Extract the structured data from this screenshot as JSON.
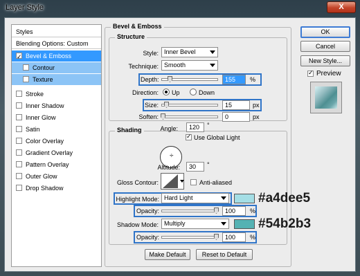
{
  "window": {
    "title": "Layer Style",
    "close_label": "X"
  },
  "sidebar": {
    "styles_label": "Styles",
    "blending_label": "Blending Options: Custom",
    "items": [
      {
        "label": "Bevel & Emboss",
        "checked": true
      },
      {
        "label": "Contour",
        "checked": false
      },
      {
        "label": "Texture",
        "checked": false
      },
      {
        "label": "Stroke",
        "checked": false
      },
      {
        "label": "Inner Shadow",
        "checked": false
      },
      {
        "label": "Inner Glow",
        "checked": false
      },
      {
        "label": "Satin",
        "checked": false
      },
      {
        "label": "Color Overlay",
        "checked": false
      },
      {
        "label": "Gradient Overlay",
        "checked": false
      },
      {
        "label": "Pattern Overlay",
        "checked": false
      },
      {
        "label": "Outer Glow",
        "checked": false
      },
      {
        "label": "Drop Shadow",
        "checked": false
      }
    ]
  },
  "bevel": {
    "section_title": "Bevel & Emboss",
    "structure": {
      "title": "Structure",
      "style_label": "Style:",
      "style_value": "Inner Bevel",
      "technique_label": "Technique:",
      "technique_value": "Smooth",
      "depth_label": "Depth:",
      "depth_value": "155",
      "depth_unit": "%",
      "depth_level": 0.155,
      "direction_label": "Direction:",
      "dir_up": "Up",
      "dir_down": "Down",
      "size_label": "Size:",
      "size_value": "15",
      "size_unit": "px",
      "size_level": 0.06,
      "soften_label": "Soften:",
      "soften_value": "0",
      "soften_unit": "px",
      "soften_level": 0
    },
    "shading": {
      "title": "Shading",
      "angle_label": "Angle:",
      "angle_value": "120",
      "angle_unit": "°",
      "global_light_label": "Use Global Light",
      "global_light_checked": true,
      "altitude_label": "Altitude:",
      "altitude_value": "30",
      "altitude_unit": "°",
      "gloss_label": "Gloss Contour:",
      "anti_aliased_label": "Anti-aliased",
      "highlight_mode_label": "Highlight Mode:",
      "highlight_mode_value": "Hard Light",
      "highlight_color": "#a4dee5",
      "highlight_opacity_label": "Opacity:",
      "highlight_opacity_value": "100",
      "highlight_opacity_unit": "%",
      "highlight_opacity_level": 1.0,
      "shadow_mode_label": "Shadow Mode:",
      "shadow_mode_value": "Multiply",
      "shadow_color": "#54b2b3",
      "shadow_opacity_label": "Opacity:",
      "shadow_opacity_value": "100",
      "shadow_opacity_unit": "%",
      "shadow_opacity_level": 1.0
    },
    "make_default_label": "Make Default",
    "reset_default_label": "Reset to Default"
  },
  "buttons": {
    "ok": "OK",
    "cancel": "Cancel",
    "new_style": "New Style...",
    "preview_label": "Preview",
    "preview_checked": true
  },
  "annotations": {
    "highlight_hex": "#a4dee5",
    "shadow_hex": "#54b2b3"
  }
}
